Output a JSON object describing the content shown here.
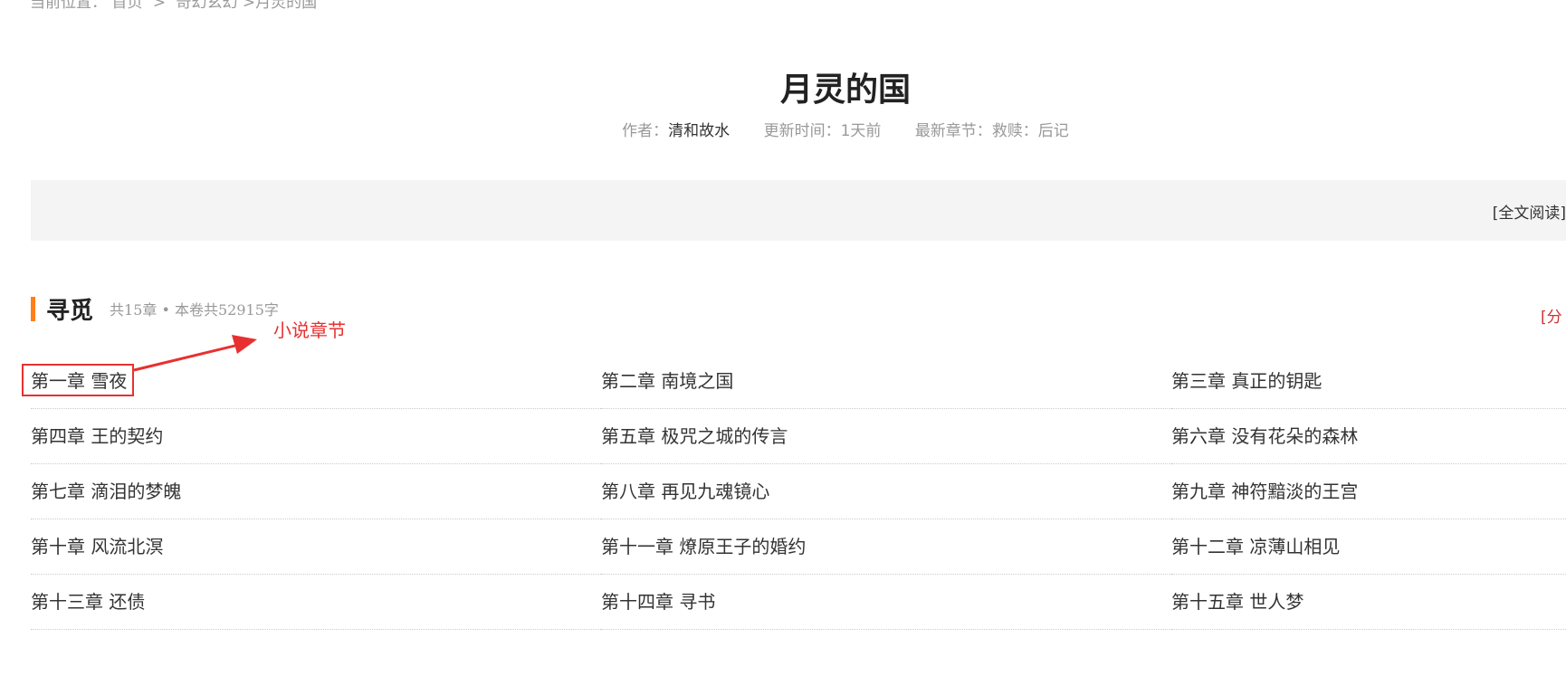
{
  "breadcrumb": {
    "prefix": "当前位置：",
    "home": "首页",
    "sep": ">",
    "category": "奇幻玄幻",
    "current": ">月灵的国"
  },
  "book": {
    "title": "月灵的国",
    "author_label": "作者：",
    "author": "清和故水",
    "updated_label": "更新时间：",
    "updated": "1天前",
    "latest_label": "最新章节：",
    "latest": "救赎：后记"
  },
  "actions": {
    "full_read": "[全文阅读]"
  },
  "volume": {
    "title": "寻觅",
    "info": "共15章 • 本卷共52915字",
    "right_link": "[分"
  },
  "chapters": [
    "第一章 雪夜",
    "第二章 南境之国",
    "第三章 真正的钥匙",
    "第四章 王的契约",
    "第五章 极咒之城的传言",
    "第六章 没有花朵的森林",
    "第七章 滴泪的梦魄",
    "第八章 再见九魂镜心",
    "第九章 神符黯淡的王宫",
    "第十章 风流北溟",
    "第十一章 燎原王子的婚约",
    "第十二章 凉薄山相见",
    "第十三章 还债",
    "第十四章 寻书",
    "第十五章 世人梦"
  ],
  "annotation": {
    "label": "小说章节",
    "color": "#e83030"
  },
  "colors": {
    "accent": "#ff7f19",
    "bar_bg": "#f4f4f4"
  }
}
